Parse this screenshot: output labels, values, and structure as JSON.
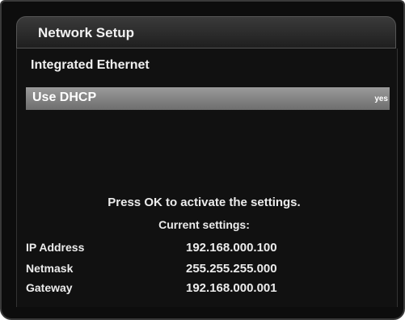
{
  "window": {
    "title": "Network Setup"
  },
  "section": {
    "title": "Integrated Ethernet"
  },
  "options": [
    {
      "label": "Use DHCP",
      "value": "yes",
      "selected": true
    }
  ],
  "prompt": "Press OK to activate the settings.",
  "current_settings": {
    "heading": "Current settings:",
    "rows": [
      {
        "label": "IP Address",
        "value": "192.168.000.100"
      },
      {
        "label": "Netmask",
        "value": "255.255.255.000"
      },
      {
        "label": "Gateway",
        "value": "192.168.000.001"
      }
    ]
  },
  "colors": {
    "background": "#0d0d0d",
    "highlight": "#8a8a8a",
    "text": "#ececec"
  }
}
